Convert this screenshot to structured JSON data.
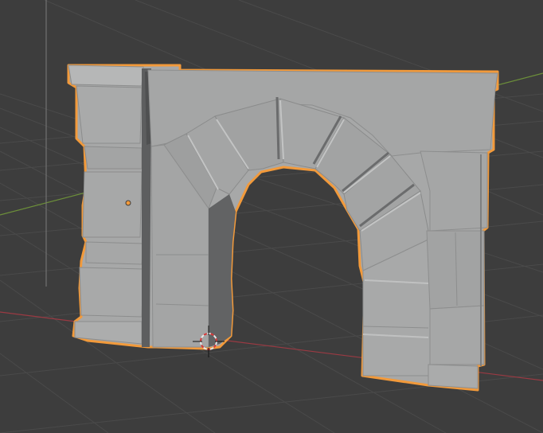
{
  "app": "Blender",
  "viewport": {
    "mode": "object",
    "background_color": "#3d3d3d",
    "grid_color": "#4a4a4a",
    "axis_x_color": "#9b3a43",
    "axis_y_color": "#6c8f3a",
    "axis_z_color": "#7a7a7a"
  },
  "object": {
    "kind": "stone-archway",
    "selected": true,
    "active": true,
    "selection_outline_color": "#f29a3b",
    "origin_color": "#f29a3b",
    "material_color": "#a7a8a8"
  },
  "cursor_3d": {
    "ring_colors": [
      "#e7e7e7",
      "#d63a3a"
    ]
  }
}
